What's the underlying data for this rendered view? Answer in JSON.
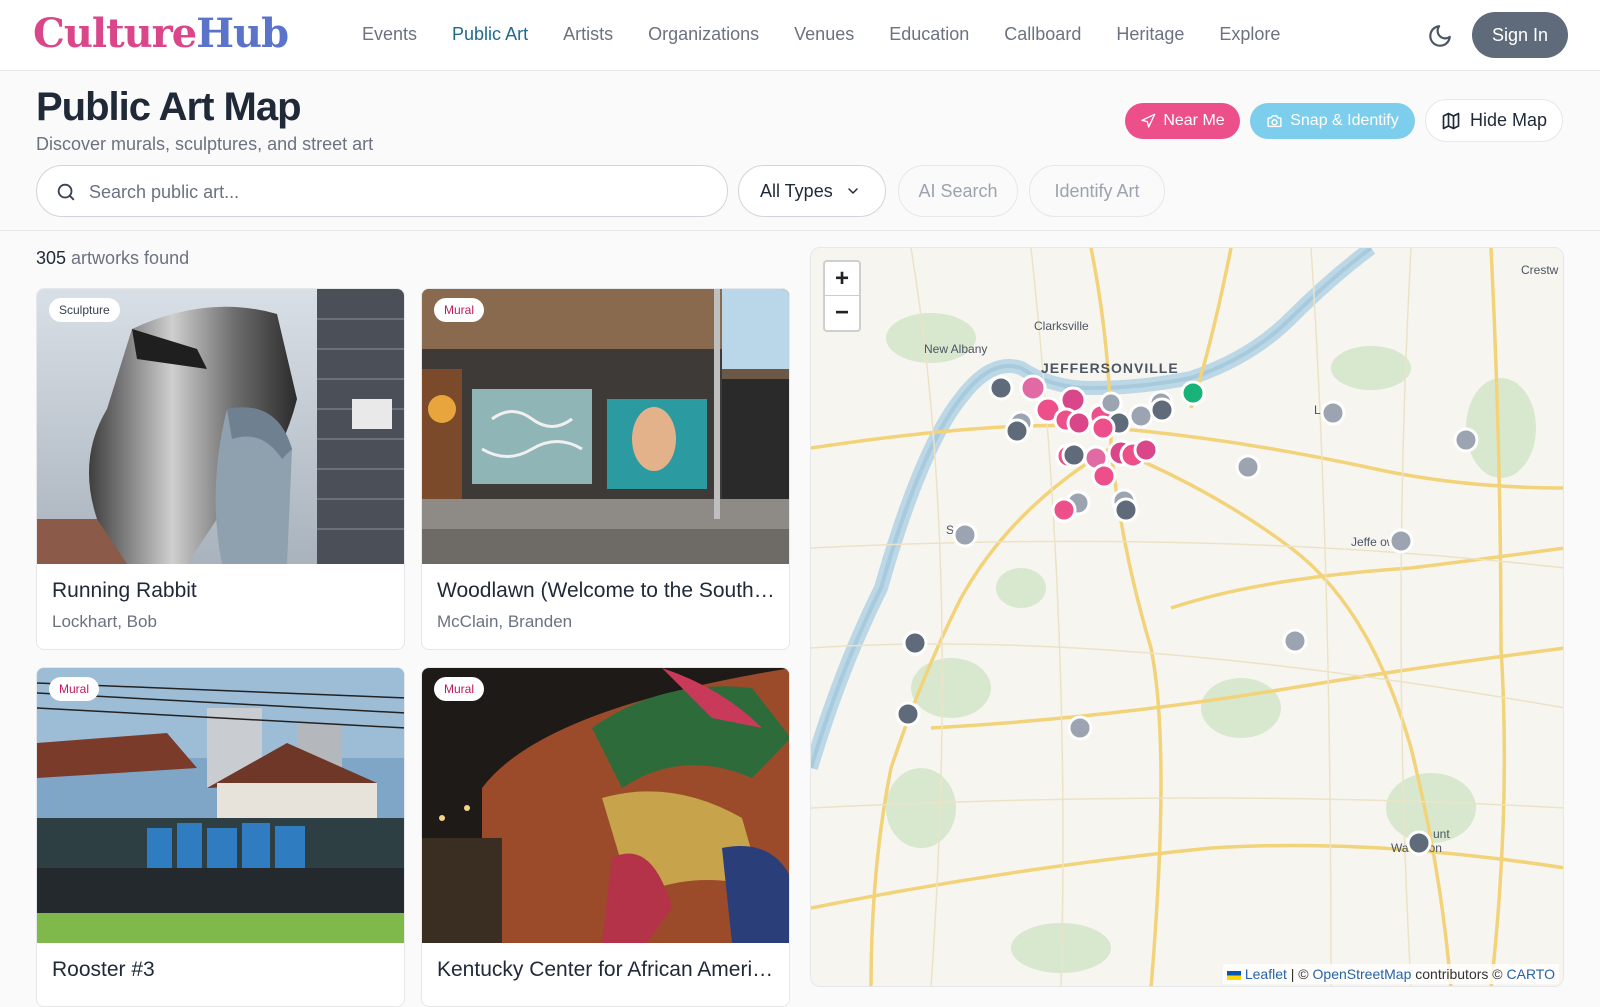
{
  "brand": {
    "part1": "Culture",
    "part2": "Hub"
  },
  "nav": {
    "items": [
      "Events",
      "Public Art",
      "Artists",
      "Organizations",
      "Venues",
      "Education",
      "Callboard",
      "Heritage",
      "Explore"
    ],
    "active": "Public Art"
  },
  "header": {
    "signin_label": "Sign In"
  },
  "page": {
    "title": "Public Art Map",
    "subtitle": "Discover murals, sculptures, and street art",
    "near_me": "Near Me",
    "snap_identify": "Snap & Identify",
    "hide_map": "Hide Map"
  },
  "filters": {
    "search_placeholder": "Search public art...",
    "type_selected": "All Types",
    "ai_search": "AI Search",
    "identify_art": "Identify Art"
  },
  "results": {
    "count": "305",
    "count_suffix": " artworks found"
  },
  "cards": [
    {
      "type": "Sculpture",
      "title": "Running Rabbit",
      "artist": "Lockhart, Bob"
    },
    {
      "type": "Mural",
      "title": "Woodlawn (Welcome to the Southside)",
      "artist": "McClain, Branden"
    },
    {
      "type": "Mural",
      "title": "Rooster #3",
      "artist": ""
    },
    {
      "type": "Mural",
      "title": "Kentucky Center for African American Heritage",
      "artist": ""
    }
  ],
  "map": {
    "labels": {
      "clarksville": "Clarksville",
      "new_albany": "New Albany",
      "jeffersonville": "JEFFERSONVILLE",
      "lyndon": "L   on",
      "shively": "S    ly",
      "jeffersontown": "Jeffe       own",
      "crestwood": "Crestw",
      "mount_washington_1": "unt",
      "mount_washington_2": "Wa    ngton"
    },
    "zoom_in": "+",
    "zoom_out": "−",
    "attribution": {
      "leaflet": "Leaflet",
      "sep": " | © ",
      "osm": "OpenStreetMap",
      "contrib": " contributors © ",
      "carto": "CARTO"
    }
  },
  "colors": {
    "accent": "#1e6a8f",
    "pink": "#ec4f8a",
    "cyan": "#7dcdec",
    "marker_gray": "#5f6b7a"
  }
}
